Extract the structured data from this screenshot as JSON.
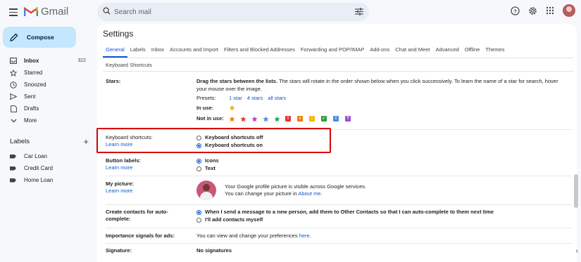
{
  "app": {
    "name": "Gmail"
  },
  "search": {
    "placeholder": "Search mail"
  },
  "compose": {
    "label": "Compose"
  },
  "nav": [
    {
      "label": "Inbox",
      "count": "322",
      "icon": "inbox-icon"
    },
    {
      "label": "Starred",
      "count": "",
      "icon": "star-outline-icon"
    },
    {
      "label": "Snoozed",
      "count": "",
      "icon": "clock-icon"
    },
    {
      "label": "Sent",
      "count": "",
      "icon": "send-icon"
    },
    {
      "label": "Drafts",
      "count": "",
      "icon": "draft-icon"
    },
    {
      "label": "More",
      "count": "",
      "icon": "chevron-down-icon"
    }
  ],
  "labels": {
    "heading": "Labels",
    "items": [
      "Car Loan",
      "Credit Card",
      "Home Loan"
    ]
  },
  "settings": {
    "title": "Settings",
    "tabs": [
      "General",
      "Labels",
      "Inbox",
      "Accounts and Import",
      "Filters and Blocked Addresses",
      "Forwarding and POP/IMAP",
      "Add-ons",
      "Chat and Meet",
      "Advanced",
      "Offline",
      "Themes"
    ],
    "tab_row2": "Keyboard Shortcuts",
    "stars": {
      "label": "Stars:",
      "desc_bold": "Drag the stars between the lists.",
      "desc": " The stars will rotate in the order shown below when you click successively. To learn the name of a star for search, hover your mouse over the image.",
      "presets_label": "Presets:",
      "presets": [
        "1 star",
        "4 stars",
        "all stars"
      ],
      "in_use_label": "In use:",
      "not_in_use_label": "Not in use:"
    },
    "keyboard": {
      "label": "Keyboard shortcuts:",
      "learn_more": "Learn more",
      "off": "Keyboard shortcuts off",
      "on": "Keyboard shortcuts on",
      "selected": "on"
    },
    "button_labels": {
      "label": "Button labels:",
      "learn_more": "Learn more",
      "icons": "Icons",
      "text": "Text",
      "selected": "icons"
    },
    "picture": {
      "label": "My picture:",
      "learn_more": "Learn more",
      "line1": "Your Google profile picture is visible across Google services.",
      "line2": "You can change your picture in ",
      "link": "About me",
      "after_link": "."
    },
    "contacts": {
      "label": "Create contacts for auto-complete:",
      "opt1": "When I send a message to a new person, add them to Other Contacts so that I can auto-complete to them next time",
      "opt2": "I'll add contacts myself",
      "selected": "opt1"
    },
    "ads": {
      "label": "Importance signals for ads:",
      "text": "You can view and change your preferences ",
      "link": "here",
      "after_link": "."
    },
    "signature": {
      "label": "Signature:",
      "value": "No signatures"
    }
  },
  "colors": {
    "accent": "#0b57d0",
    "compose_bg": "#c2e7ff",
    "highlight": "#d90000",
    "star_yellow": "#f4b400"
  }
}
